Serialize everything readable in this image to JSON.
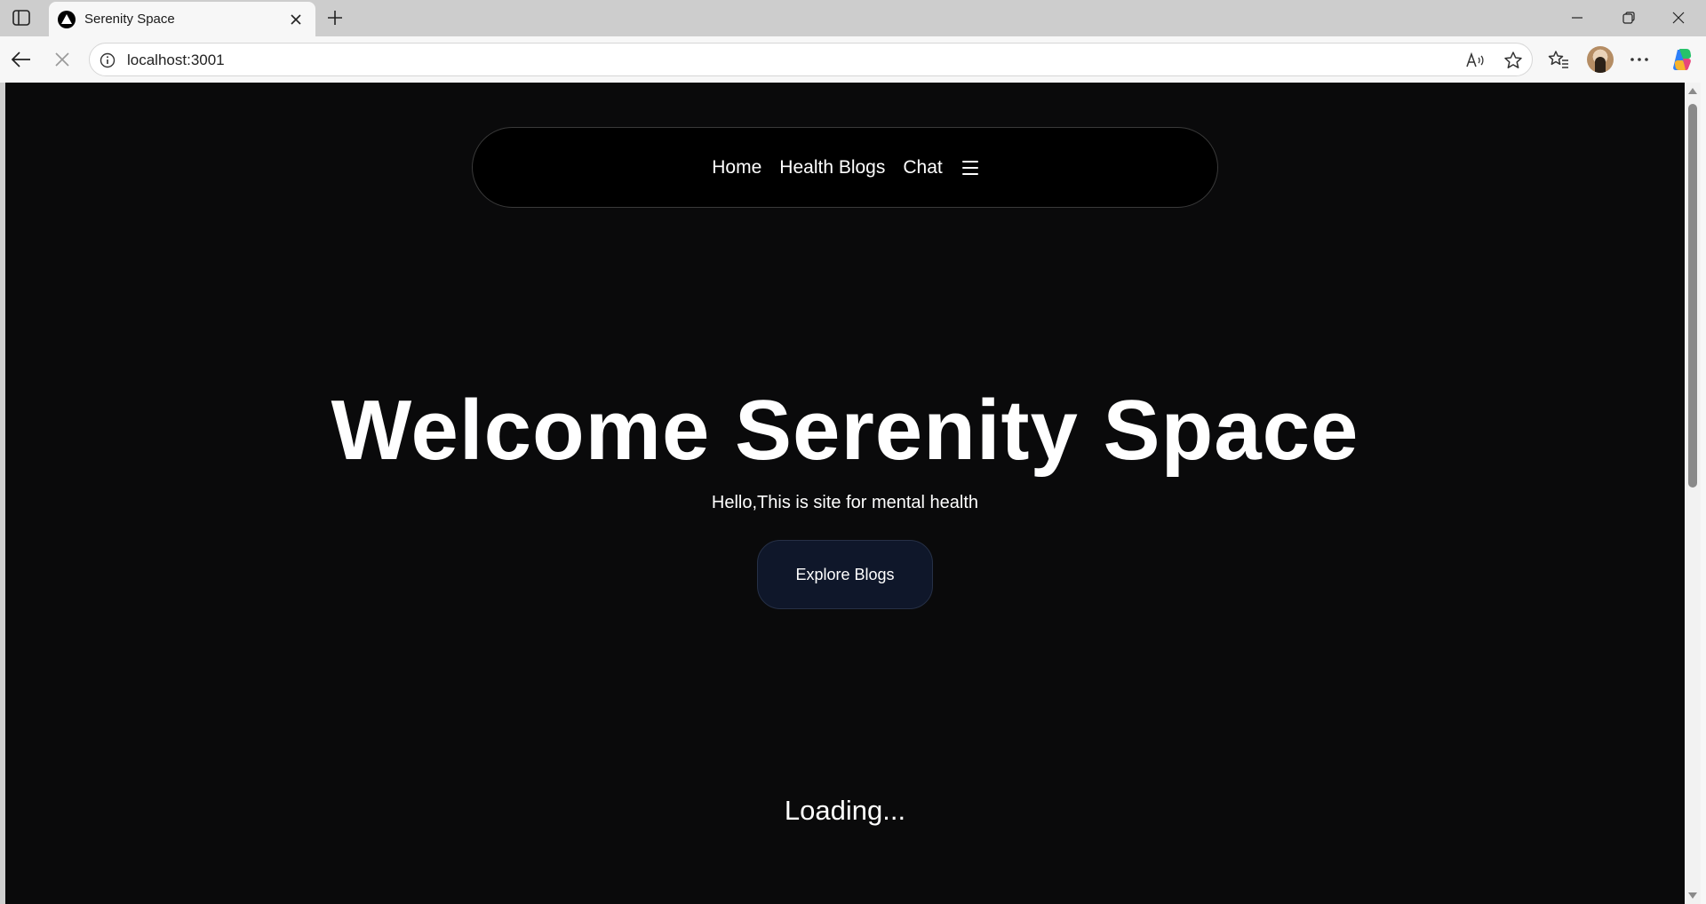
{
  "browser": {
    "tab": {
      "title": "Serenity Space"
    },
    "address": {
      "url": "localhost:3001"
    }
  },
  "page": {
    "nav": {
      "links": [
        {
          "label": "Home"
        },
        {
          "label": "Health Blogs"
        },
        {
          "label": "Chat"
        }
      ]
    },
    "hero": {
      "title": "Welcome Serenity Space",
      "subtitle": "Hello,This is site for mental health",
      "button_label": "Explore Blogs"
    },
    "loading_text": "Loading...",
    "colors": {
      "background": "#0a0a0b",
      "nav_background": "#000000",
      "button_background": "#0f172a",
      "text": "#ffffff"
    }
  },
  "icons": {
    "tab_actions": "tab-actions-icon",
    "favicon": "triangle-icon",
    "tab_close": "close-icon",
    "new_tab": "plus-icon",
    "minimize": "minimize-icon",
    "restore": "restore-icon",
    "window_close": "close-icon",
    "back": "back-arrow-icon",
    "stop": "stop-icon",
    "site_info": "info-icon",
    "read_aloud": "read-aloud-icon",
    "favorite": "star-icon",
    "favorites": "favorites-icon",
    "more": "more-icon",
    "copilot": "copilot-icon",
    "menu": "hamburger-icon"
  }
}
